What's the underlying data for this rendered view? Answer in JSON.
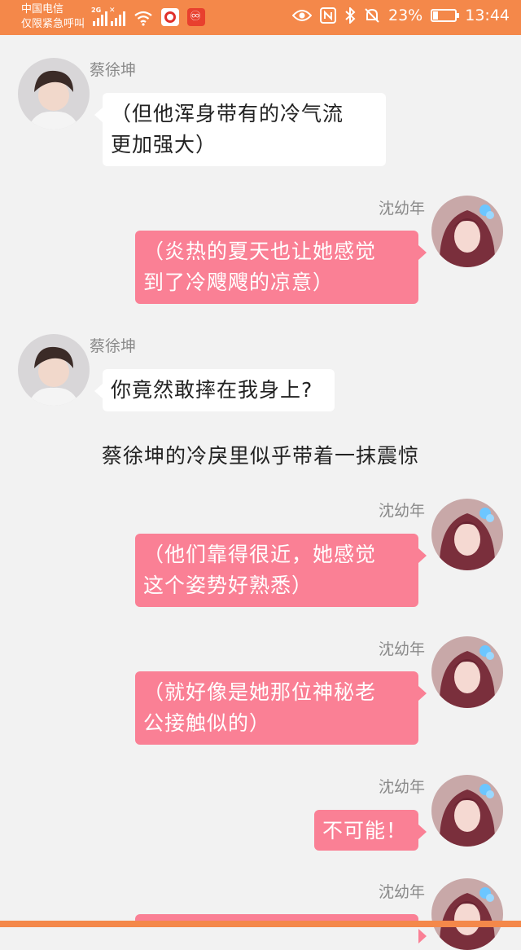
{
  "status_bar": {
    "carrier_line1": "中国电信",
    "carrier_line2": "仅限紧急呼叫",
    "network_tag": "2G",
    "battery_percent": "23%",
    "battery_level": 0.23,
    "time": "13:44",
    "icons": [
      "eye-icon",
      "nfc-icon",
      "bluetooth-icon",
      "mute-bell-icon",
      "battery-icon"
    ],
    "accent": "#f4884a"
  },
  "characters": {
    "left": {
      "name": "蔡徐坤"
    },
    "right": {
      "name": "沈幼年"
    }
  },
  "messages": [
    {
      "side": "left",
      "name": "蔡徐坤",
      "lines": [
        "（但他浑身带有的冷气流",
        "更加强大）"
      ]
    },
    {
      "side": "right",
      "name": "沈幼年",
      "lines": [
        "（炎热的夏天也让她感觉",
        "到了冷飕飕的凉意）"
      ]
    },
    {
      "side": "left",
      "name": "蔡徐坤",
      "lines": [
        "你竟然敢摔在我身上?"
      ]
    },
    {
      "side": "narration",
      "text": "蔡徐坤的冷戾里似乎带着一抹震惊"
    },
    {
      "side": "right",
      "name": "沈幼年",
      "lines": [
        "（他们靠得很近，她感觉",
        "这个姿势好熟悉）"
      ]
    },
    {
      "side": "right",
      "name": "沈幼年",
      "lines": [
        "（就好像是她那位神秘老",
        "公接触似的）"
      ]
    },
    {
      "side": "right",
      "name": "沈幼年",
      "lines": [
        "不可能！"
      ]
    },
    {
      "side": "right",
      "name": "沈幼年",
      "lines": []
    }
  ],
  "colors": {
    "bubble_right": "#fa8095",
    "bubble_left": "#ffffff",
    "background": "#f2f2f2"
  }
}
